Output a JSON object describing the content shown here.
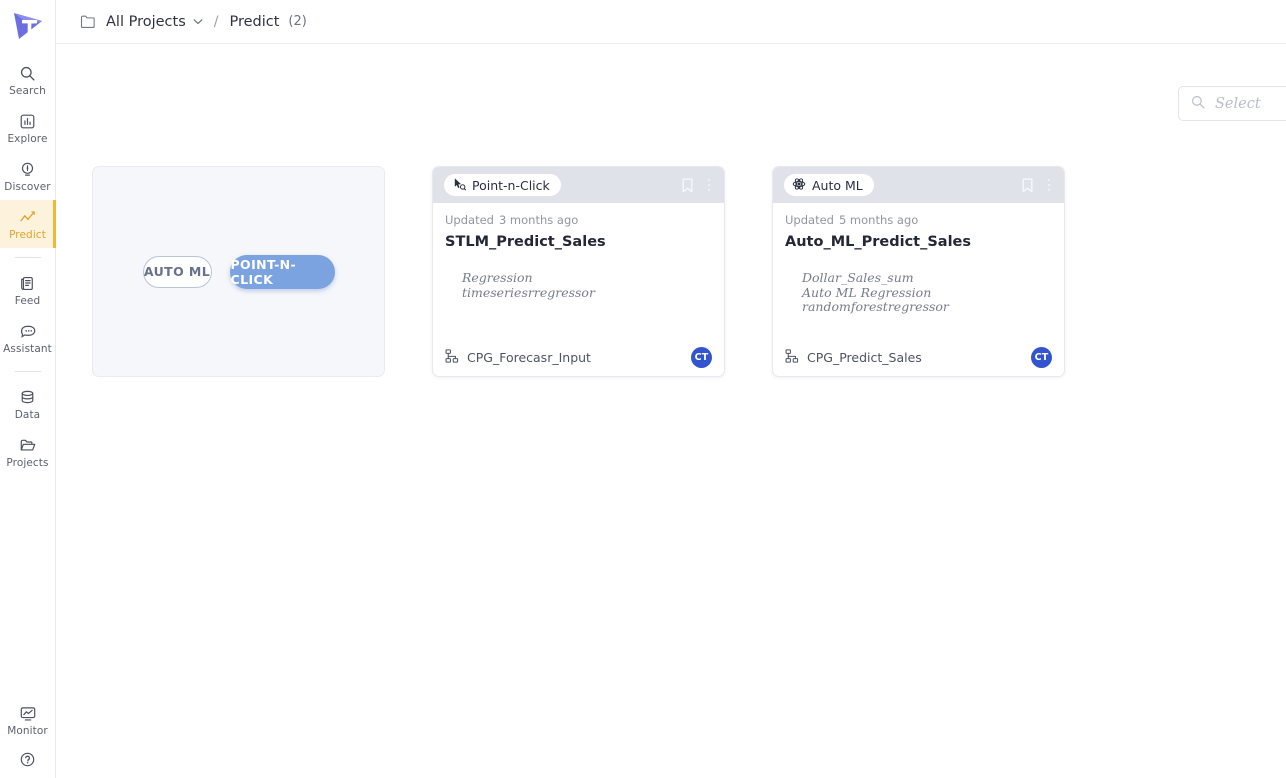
{
  "app": {
    "logo_alt": "thoughtspot-logo",
    "accent_active": "#f0b838",
    "accent_blue": "#7ba3e0",
    "avatar_color": "#3454cf"
  },
  "sidebar": {
    "items": [
      {
        "label": "Search",
        "icon": "search-icon",
        "active": false
      },
      {
        "label": "Explore",
        "icon": "explore-icon",
        "active": false
      },
      {
        "label": "Discover",
        "icon": "discover-icon",
        "active": false
      },
      {
        "label": "Predict",
        "icon": "predict-icon",
        "active": true
      },
      {
        "label": "Feed",
        "icon": "feed-icon",
        "active": false
      },
      {
        "label": "Assistant",
        "icon": "assistant-icon",
        "active": false
      },
      {
        "label": "Data",
        "icon": "data-icon",
        "active": false
      },
      {
        "label": "Projects",
        "icon": "projects-icon",
        "active": false
      },
      {
        "label": "Monitor",
        "icon": "monitor-icon",
        "active": false
      }
    ],
    "help_icon": "help-icon"
  },
  "breadcrumb": {
    "folder_icon": "folder-icon",
    "root": "All Projects",
    "caret_icon": "chevron-down-icon",
    "separator": "/",
    "current": "Predict",
    "count": "(2)"
  },
  "search": {
    "icon": "search-icon",
    "placeholder": "Select",
    "value": ""
  },
  "choice_card": {
    "auto_ml_label": "AUTO ML",
    "point_n_click_label": "POINT-N-CLICK"
  },
  "cards": [
    {
      "badge_label": "Point-n-Click",
      "badge_icon": "point-n-click-icon",
      "updated_label": "Updated",
      "updated_value": "3 months ago",
      "title": "STLM_Predict_Sales",
      "meta": [
        "Regression",
        "timeseriesrregressor"
      ],
      "dataset": "CPG_Forecasr_Input",
      "dataset_icon": "dataset-icon",
      "avatar_initials": "CT",
      "bookmark_icon": "bookmark-icon",
      "menu_icon": "kebab-menu-icon"
    },
    {
      "badge_label": "Auto ML",
      "badge_icon": "auto-ml-icon",
      "updated_label": "Updated",
      "updated_value": "5 months ago",
      "title": "Auto_ML_Predict_Sales",
      "meta": [
        "Dollar_Sales_sum",
        "Auto ML Regression",
        "randomforestregressor"
      ],
      "dataset": "CPG_Predict_Sales",
      "dataset_icon": "dataset-icon",
      "avatar_initials": "CT",
      "bookmark_icon": "bookmark-icon",
      "menu_icon": "kebab-menu-icon"
    }
  ]
}
